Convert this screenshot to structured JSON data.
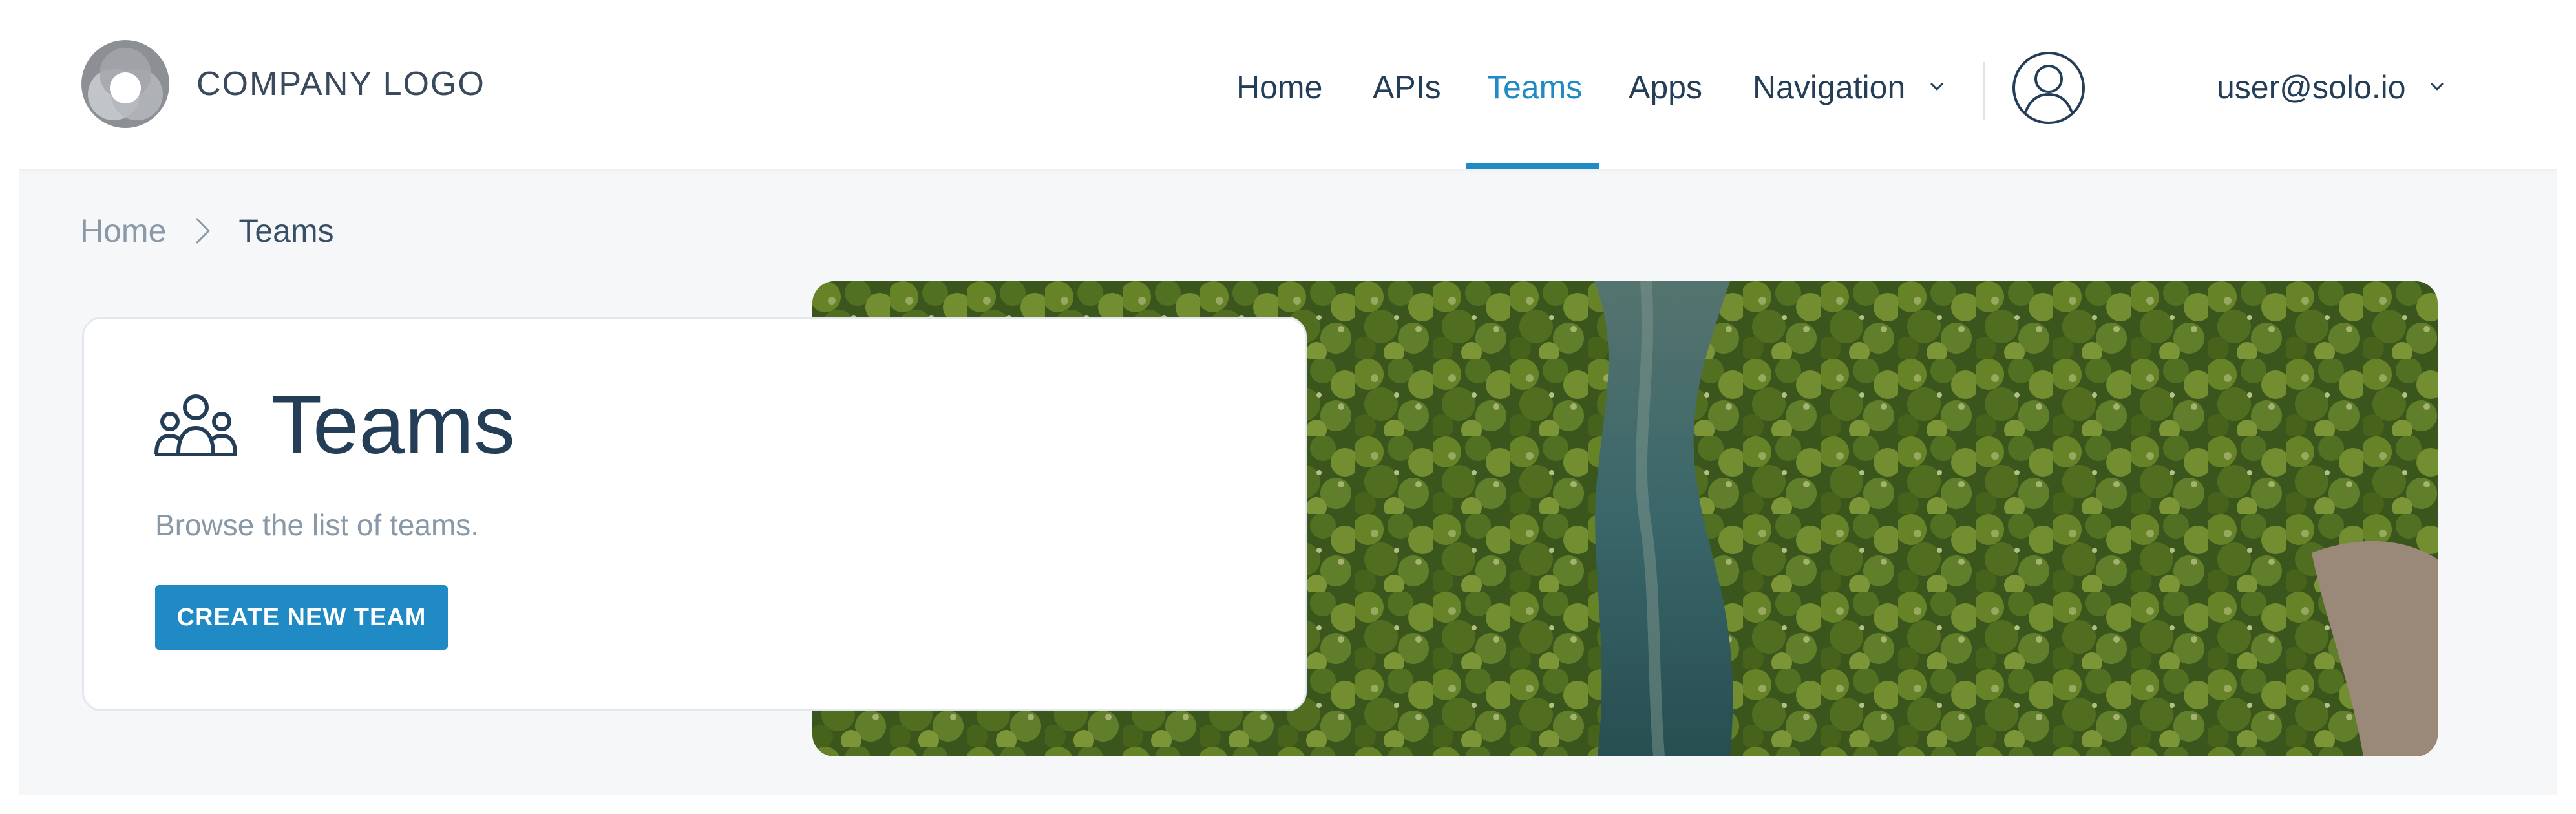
{
  "header": {
    "logo_text": "COMPANY LOGO",
    "nav": [
      {
        "label": "Home"
      },
      {
        "label": "APIs"
      },
      {
        "label": "Teams",
        "active": true
      },
      {
        "label": "Apps"
      },
      {
        "label": "Navigation",
        "has_dropdown": true
      }
    ],
    "user_email": "user@solo.io"
  },
  "breadcrumb": {
    "home": "Home",
    "current": "Teams"
  },
  "card": {
    "icon": "team-icon",
    "title": "Teams",
    "description": "Browse the list of teams.",
    "button_label": "CREATE NEW TEAM"
  },
  "colors": {
    "accent": "#1f8ac4",
    "text": "#253e58",
    "muted": "#8a99a8",
    "background": "#f5f7f9"
  }
}
